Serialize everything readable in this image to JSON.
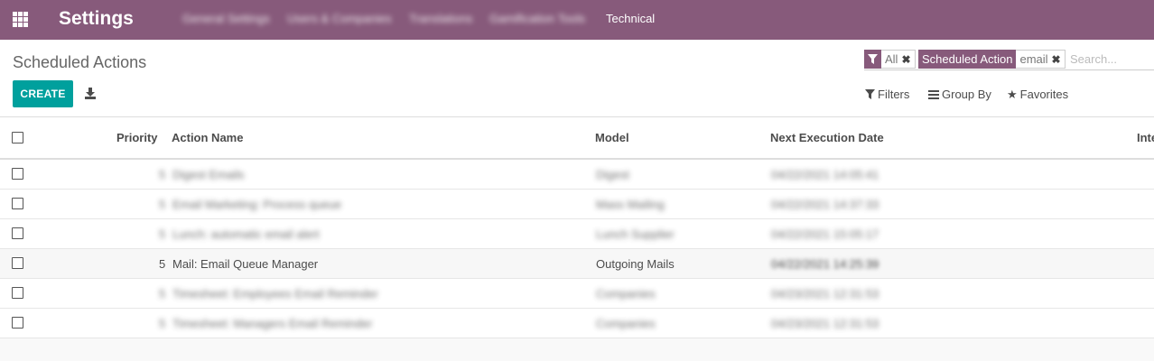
{
  "navbar": {
    "brand": "Settings",
    "menu": [
      {
        "label": "General Settings",
        "blurred": true
      },
      {
        "label": "Users & Companies",
        "blurred": true
      },
      {
        "label": "Translations",
        "blurred": true
      },
      {
        "label": "Gamification Tools",
        "blurred": true
      },
      {
        "label": "Technical",
        "blurred": false
      }
    ],
    "color": "#875a7b"
  },
  "breadcrumb": "Scheduled Actions",
  "buttons": {
    "create": "CREATE"
  },
  "search": {
    "facets": [
      {
        "icon": "filter-icon",
        "label": "",
        "value": "All"
      },
      {
        "icon": "",
        "label": "Scheduled Action",
        "value": "email"
      }
    ],
    "placeholder": "Search..."
  },
  "options": {
    "filters": "Filters",
    "group_by": "Group By",
    "favorites": "Favorites"
  },
  "table": {
    "columns": {
      "priority": "Priority",
      "action_name": "Action Name",
      "model": "Model",
      "next_execution": "Next Execution Date",
      "interval": "Inte"
    },
    "rows": [
      {
        "priority": "5",
        "name": "Digest Emails",
        "model": "Digest",
        "date": "04/22/2021 14:05:41",
        "blurred": true
      },
      {
        "priority": "5",
        "name": "Email Marketing: Process queue",
        "model": "Mass Mailing",
        "date": "04/22/2021 14:37:33",
        "blurred": true
      },
      {
        "priority": "5",
        "name": "Lunch: automatic email alert",
        "model": "Lunch Supplier",
        "date": "04/22/2021 15:05:17",
        "blurred": true
      },
      {
        "priority": "5",
        "name": "Mail: Email Queue Manager",
        "model": "Outgoing Mails",
        "date": "04/22/2021 14:25:39",
        "blurred": false
      },
      {
        "priority": "5",
        "name": "Timesheet: Employees Email Reminder",
        "model": "Companies",
        "date": "04/23/2021 12:31:53",
        "blurred": true
      },
      {
        "priority": "5",
        "name": "Timesheet: Managers Email Reminder",
        "model": "Companies",
        "date": "04/23/2021 12:31:53",
        "blurred": true
      }
    ]
  },
  "colors": {
    "accent": "#00a09d",
    "brand": "#875a7b"
  }
}
